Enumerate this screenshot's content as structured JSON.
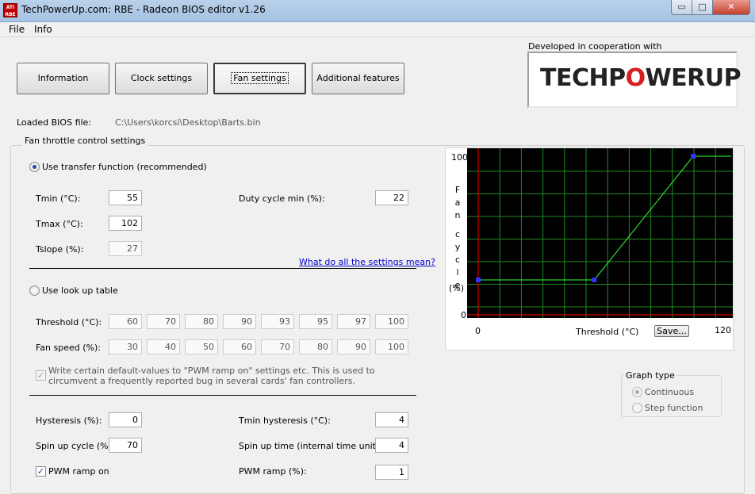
{
  "window": {
    "title": "TechPowerUp.com: RBE - Radeon BIOS editor v1.26",
    "icon_text": "ATI RBE",
    "minimize_glyph": "▭",
    "maximize_glyph": "□",
    "close_glyph": "✕"
  },
  "menu": [
    "File",
    "Info"
  ],
  "tabs": [
    {
      "label": "Information"
    },
    {
      "label": "Clock settings"
    },
    {
      "label": "Fan settings",
      "active": true
    },
    {
      "label": "Additional features"
    }
  ],
  "logo": {
    "caption": "Developed in cooperation with",
    "text_pre": "TECHP",
    "text_o": "O",
    "text_post": "WERUP"
  },
  "bios": {
    "label": "Loaded BIOS file:",
    "path": "C:\\Users\\korcsi\\Desktop\\Barts.bin"
  },
  "fan": {
    "group_title": "Fan throttle control settings",
    "transfer_label": "Use transfer function (recommended)",
    "tmin_label": "Tmin (°C):",
    "tmin": "55",
    "tmax_label": "Tmax (°C):",
    "tmax": "102",
    "tslope_label": "Tslope (%):",
    "tslope": "27",
    "duty_min_label": "Duty cycle min (%):",
    "duty_min": "22",
    "help_link": "What do all the settings mean?",
    "lookup_label": "Use look up table",
    "threshold_label": "Threshold (°C):",
    "thresholds": [
      "60",
      "70",
      "80",
      "90",
      "93",
      "95",
      "97",
      "100"
    ],
    "fanspeed_label": "Fan speed (%):",
    "fanspeeds": [
      "30",
      "40",
      "50",
      "60",
      "70",
      "80",
      "90",
      "100"
    ],
    "pwm_default_line1": "Write certain default-values to \"PWM ramp on\" settings etc. This is used to",
    "pwm_default_line2": "circumvent a frequently reported bug in several cards' fan controllers.",
    "hysteresis_label": "Hysteresis (%):",
    "hysteresis": "0",
    "tmin_hyst_label": "Tmin hysteresis (°C):",
    "tmin_hyst": "4",
    "spinup_cycle_label": "Spin up cycle (%):",
    "spinup_cycle": "70",
    "spinup_time_label": "Spin up time (internal time units):",
    "spinup_time": "4",
    "pwm_ramp_on_label": "PWM ramp on",
    "pwm_ramp_label": "PWM ramp (%):",
    "pwm_ramp": "1"
  },
  "graph": {
    "ylabel_chars": [
      "F",
      "a",
      "n",
      "c",
      "y",
      "c",
      "l",
      "e",
      "(%)"
    ],
    "xlabel": "Threshold (°C)",
    "y_top": "100",
    "y_bottom": "0",
    "x_left": "0",
    "x_right": "120",
    "save_label": "Save...",
    "colors": {
      "background": "#000000",
      "grid": "#1f8a1f",
      "axis": "#ff0000",
      "curve": "#33ff33",
      "points": "#3333ff"
    },
    "chart_data": {
      "type": "line",
      "xlabel": "Threshold (°C)",
      "ylabel": "Fan cycle (%)",
      "xlim": [
        0,
        120
      ],
      "ylim": [
        0,
        100
      ],
      "x": [
        0,
        55,
        102,
        120
      ],
      "y": [
        22,
        22,
        100,
        100
      ],
      "grid": true
    }
  },
  "graph_type": {
    "title": "Graph type",
    "continuous": "Continuous",
    "step": "Step function"
  }
}
